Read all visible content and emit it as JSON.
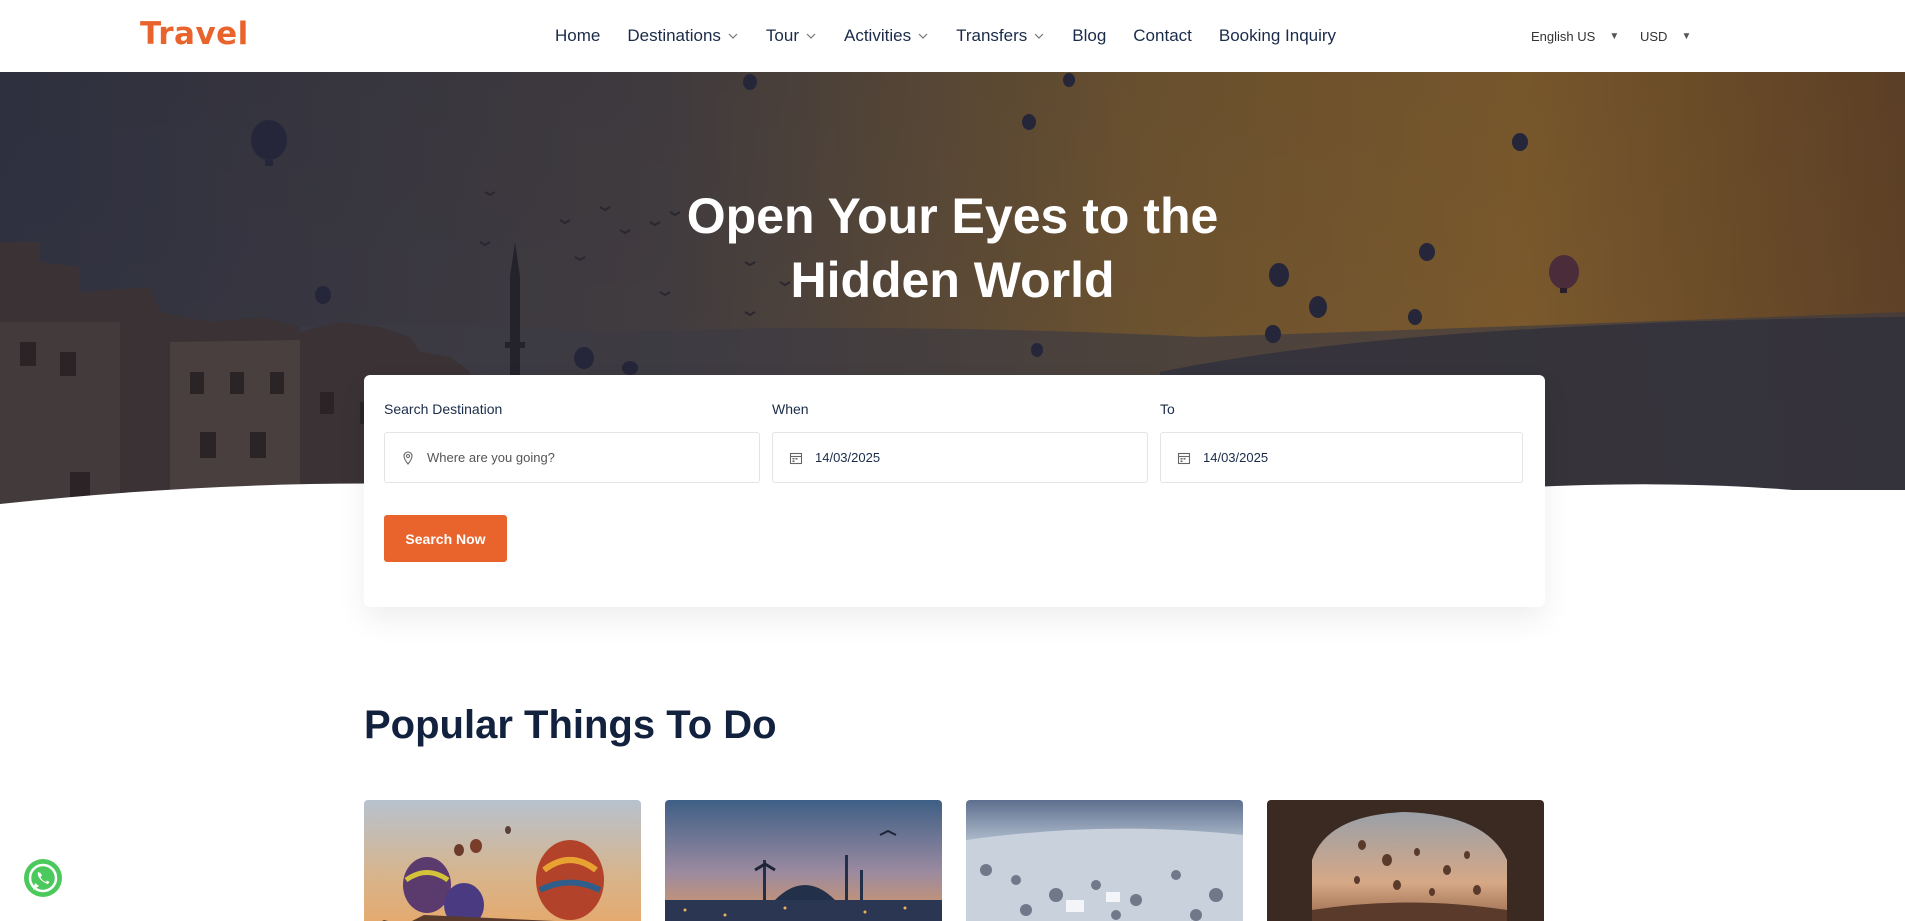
{
  "brand": {
    "logo_text": "Travel",
    "accent": "#e8642c"
  },
  "nav": {
    "items": [
      {
        "label": "Home",
        "has_dropdown": false
      },
      {
        "label": "Destinations",
        "has_dropdown": true
      },
      {
        "label": "Tour",
        "has_dropdown": true
      },
      {
        "label": "Activities",
        "has_dropdown": true
      },
      {
        "label": "Transfers",
        "has_dropdown": true
      },
      {
        "label": "Blog",
        "has_dropdown": false
      },
      {
        "label": "Contact",
        "has_dropdown": false
      },
      {
        "label": "Booking Inquiry",
        "has_dropdown": false
      }
    ],
    "language": "English US",
    "currency": "USD"
  },
  "hero": {
    "title_line1": "Open Your Eyes to the",
    "title_line2": "Hidden World"
  },
  "search": {
    "destination_label": "Search Destination",
    "destination_placeholder": "Where are you going?",
    "when_label": "When",
    "when_value": "14/03/2025",
    "to_label": "To",
    "to_value": "14/03/2025",
    "button_label": "Search Now"
  },
  "popular": {
    "title": "Popular Things To Do"
  },
  "icons": {
    "whatsapp": "whatsapp-icon",
    "location": "map-pin-icon",
    "calendar": "calendar-icon",
    "dropdown": "chevron-down-icon"
  }
}
